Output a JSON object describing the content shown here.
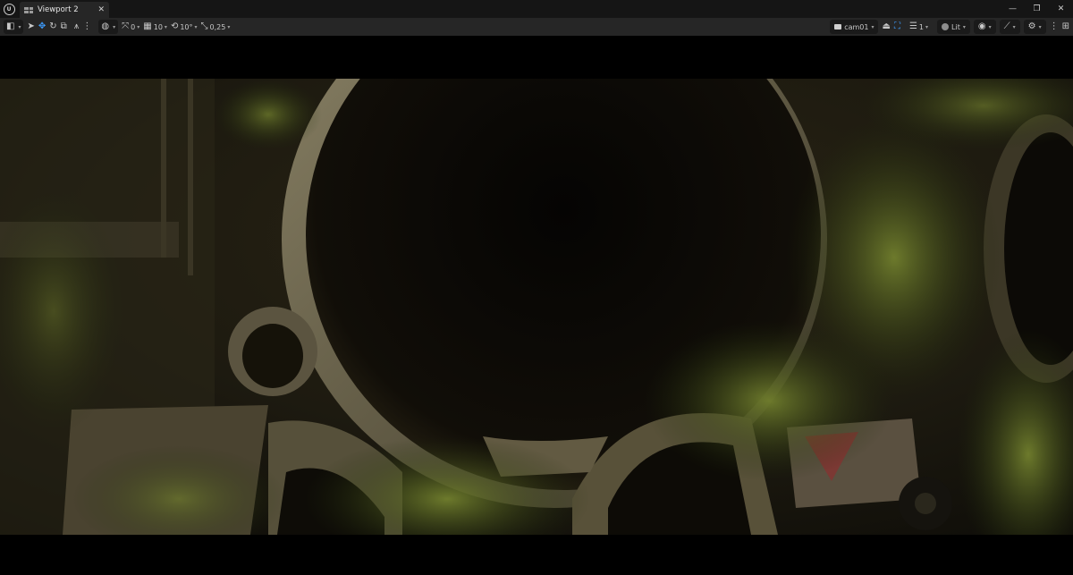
{
  "window": {
    "tab_label": "Viewport 2",
    "tab_close": "✕",
    "controls": {
      "minimize": "—",
      "restore": "❐",
      "close": "✕"
    }
  },
  "toolbar": {
    "left": {
      "select_mode_icon": "select-mode-icon",
      "transform_icons": [
        "cursor-icon",
        "move-icon",
        "rotate-icon",
        "scale-icon"
      ],
      "surface_snap_icon": "surface-snap-icon",
      "menu_icon": "kebab-menu-icon",
      "coord_icon": "world-coords-icon",
      "grid_snap_value": "0",
      "grid_size_value": "10",
      "rotation_snap_value": "10°",
      "scale_snap_value": "0,25"
    },
    "right": {
      "camera_label": "cam01",
      "eject_icon": "eject-icon",
      "pilot_icon": "pilot-icon",
      "speed_value": "1",
      "lit_label": "Lit",
      "show_icon": "eye-icon",
      "realtime_icon": "realtime-icon",
      "settings_icon": "gear-icon",
      "layout_icon": "layout-icon"
    }
  },
  "viewport": {
    "description_only": false
  },
  "colors": {
    "accent": "#3d9dff",
    "toolbar_bg": "#262626",
    "title_bg": "#151515"
  }
}
